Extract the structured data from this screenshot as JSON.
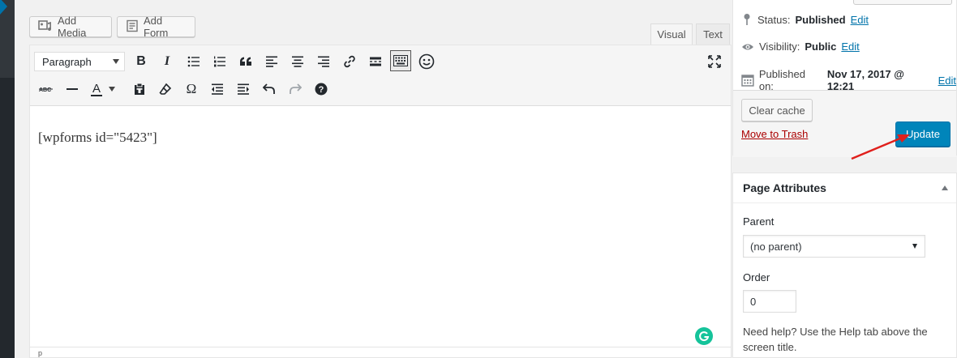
{
  "media_buttons": {
    "add_media": "Add Media",
    "add_form": "Add Form"
  },
  "editor_tabs": {
    "visual": "Visual",
    "text": "Text"
  },
  "toolbar": {
    "format_select": "Paragraph",
    "bold": "B",
    "italic": "I",
    "text_color": "A",
    "special_char": "Ω"
  },
  "editor": {
    "content": "[wpforms id=\"5423\"]",
    "status_path": "p"
  },
  "publish": {
    "status_label": "Status:",
    "status_value": "Published",
    "visibility_label": "Visibility:",
    "visibility_value": "Public",
    "published_label": "Published on:",
    "published_value": "Nov 17, 2017 @ 12:21",
    "edit_link": "Edit",
    "clear_cache": "Clear cache",
    "move_to_trash": "Move to Trash",
    "update": "Update"
  },
  "page_attributes": {
    "title": "Page Attributes",
    "parent_label": "Parent",
    "parent_value": "(no parent)",
    "order_label": "Order",
    "order_value": "0",
    "help": "Need help? Use the Help tab above the screen title."
  },
  "colors": {
    "primary": "#0085ba",
    "link": "#0073aa",
    "trash": "#a00",
    "annotation_arrow": "#e0201c",
    "grammarly": "#15c39a"
  }
}
